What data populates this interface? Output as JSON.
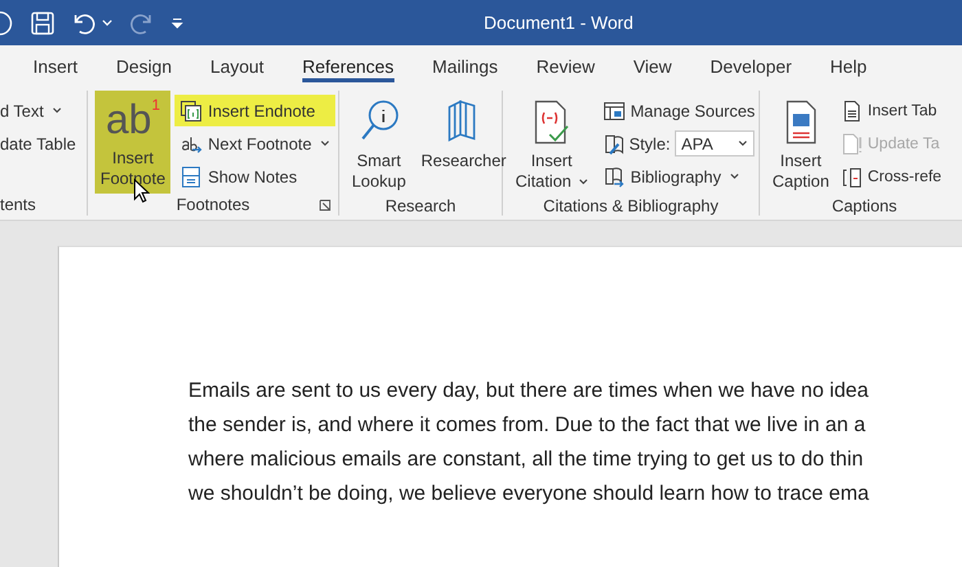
{
  "window": {
    "title": "Document1 - Word"
  },
  "tabs": [
    {
      "label": "Insert",
      "selected": false
    },
    {
      "label": "Design",
      "selected": false
    },
    {
      "label": "Layout",
      "selected": false
    },
    {
      "label": "References",
      "selected": true
    },
    {
      "label": "Mailings",
      "selected": false
    },
    {
      "label": "Review",
      "selected": false
    },
    {
      "label": "View",
      "selected": false
    },
    {
      "label": "Developer",
      "selected": false
    },
    {
      "label": "Help",
      "selected": false
    }
  ],
  "ribbon": {
    "groups": [
      {
        "label": "tents",
        "items": [
          {
            "kind": "small",
            "label": "d Text",
            "dropdown": true
          },
          {
            "kind": "small",
            "label": "date Table"
          }
        ]
      },
      {
        "label": "Footnotes",
        "launcher": true,
        "items": [
          {
            "kind": "large",
            "lines": [
              "Insert",
              "Footnote"
            ],
            "glyph": "ab",
            "glyph_mark": "1",
            "highlighted": true,
            "hovered": true
          },
          {
            "kind": "small",
            "label": "Insert Endnote",
            "highlighted": true
          },
          {
            "kind": "small",
            "label": "Next Footnote",
            "dropdown": true
          },
          {
            "kind": "small",
            "label": "Show Notes"
          }
        ]
      },
      {
        "label": "Research",
        "items": [
          {
            "kind": "large",
            "lines": [
              "Smart",
              "Lookup"
            ]
          },
          {
            "kind": "large",
            "lines": [
              "Researcher"
            ]
          }
        ]
      },
      {
        "label": "Citations & Bibliography",
        "items": [
          {
            "kind": "large",
            "lines": [
              "Insert",
              "Citation"
            ],
            "dropdown": true
          },
          {
            "kind": "small",
            "label": "Manage Sources"
          },
          {
            "kind": "select",
            "label": "Style:",
            "value": "APA"
          },
          {
            "kind": "small",
            "label": "Bibliography",
            "dropdown": true
          }
        ]
      },
      {
        "label": "Captions",
        "items": [
          {
            "kind": "large",
            "lines": [
              "Insert",
              "Caption"
            ]
          },
          {
            "kind": "small",
            "label": "Insert Tab"
          },
          {
            "kind": "small",
            "label": "Update Ta",
            "disabled": true
          },
          {
            "kind": "small",
            "label": "Cross-refe"
          }
        ]
      }
    ]
  },
  "document": {
    "lines": [
      "Emails are sent to us every day, but there are times when we have no idea",
      "the sender is, and where it comes from. Due to the fact that we live in an a",
      "where malicious emails are constant, all the time trying to get us to do thin",
      "we shouldn’t be doing, we believe everyone should learn how to trace ema"
    ]
  }
}
